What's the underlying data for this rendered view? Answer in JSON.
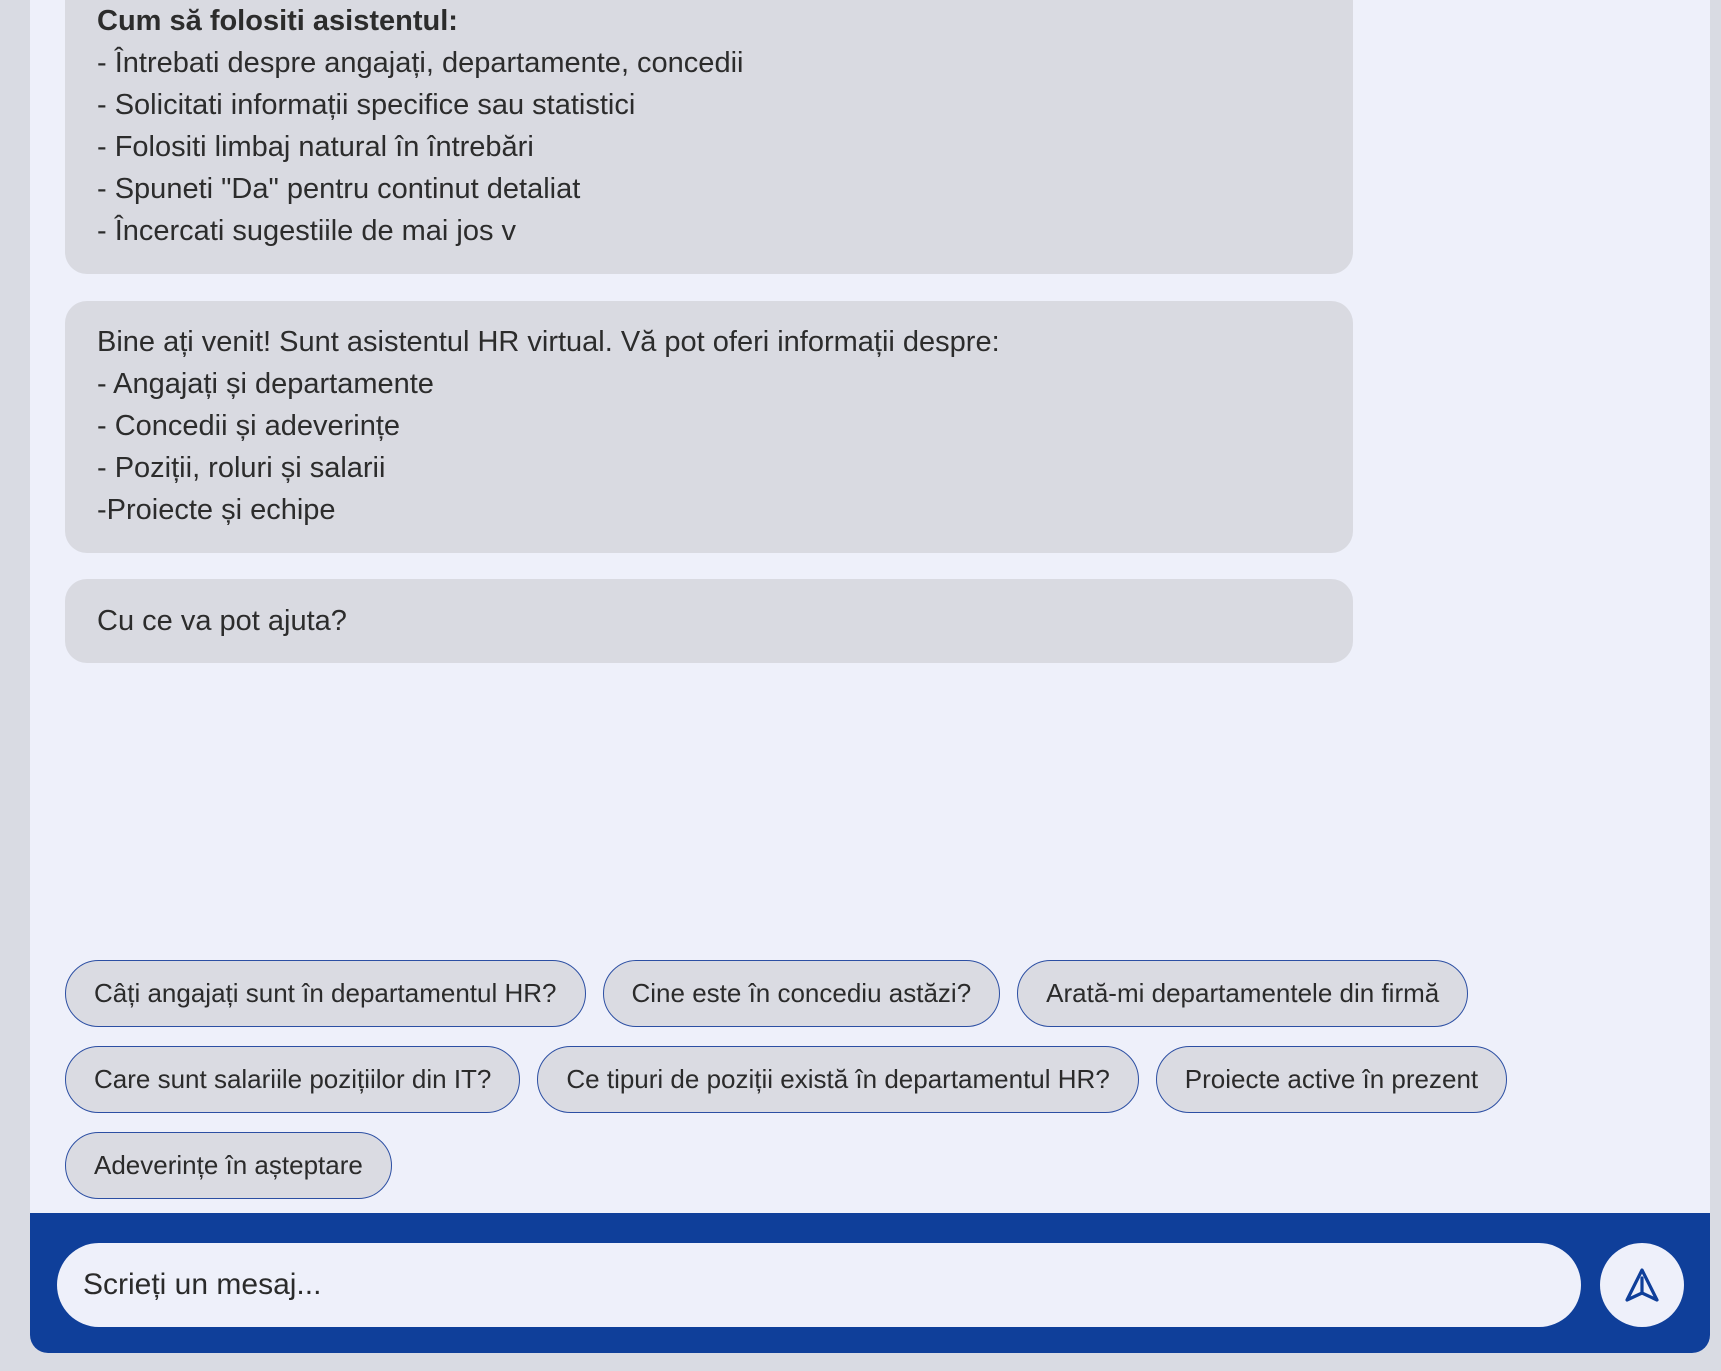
{
  "messages": {
    "help": {
      "title": "Cum să folositi asistentul:",
      "lines": [
        "- Întrebati despre angajați, departamente, concedii",
        "- Solicitati informații specifice sau statistici",
        "- Folositi limbaj natural în întrebări",
        "- Spuneti \"Da\" pentru continut detaliat",
        "- Încercati sugestiile de mai jos v"
      ]
    },
    "welcome": {
      "lines": [
        "Bine ați venit! Sunt asistentul HR virtual. Vă pot oferi informații despre:",
        "- Angajați și departamente",
        "- Concedii și adeverințe",
        "- Poziții, roluri și salarii",
        "-Proiecte și echipe"
      ]
    },
    "question": "Cu ce va pot ajuta?"
  },
  "suggestions": [
    "Câți angajați sunt în departamentul HR?",
    "Cine este în concediu astăzi?",
    "Arată-mi departamentele din firmă",
    "Care sunt salariile pozițiilor din IT?",
    "Ce tipuri de poziții există în departamentul HR?",
    "Proiecte active în prezent",
    "Adeverințe în așteptare"
  ],
  "composer": {
    "placeholder": "Scrieți un mesaj...",
    "send_icon": "send-icon"
  },
  "colors": {
    "brand": "#0f3f9a",
    "bubble": "#d9dae1",
    "background": "#eef0fa",
    "chip_border": "#2c4fa3"
  }
}
